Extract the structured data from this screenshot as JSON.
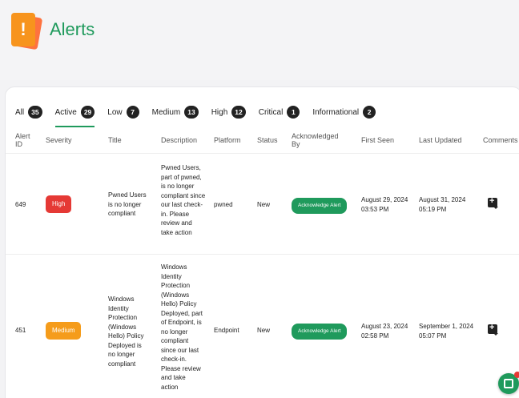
{
  "page": {
    "title": "Alerts"
  },
  "tabs": [
    {
      "label": "All",
      "count": "35"
    },
    {
      "label": "Active",
      "count": "29"
    },
    {
      "label": "Low",
      "count": "7"
    },
    {
      "label": "Medium",
      "count": "13"
    },
    {
      "label": "High",
      "count": "12"
    },
    {
      "label": "Critical",
      "count": "1"
    },
    {
      "label": "Informational",
      "count": "2"
    }
  ],
  "table": {
    "headers": {
      "alert_id": "Alert ID",
      "severity": "Severity",
      "title": "Title",
      "description": "Description",
      "platform": "Platform",
      "status": "Status",
      "acknowledged_by": "Acknowledged By",
      "first_seen": "First Seen",
      "last_updated": "Last Updated",
      "comments": "Comments"
    },
    "rows": [
      {
        "alert_id": "649",
        "severity": "High",
        "title": "Pwned Users is no longer compliant",
        "description": "Pwned Users, part of pwned, is no longer compliant since our last check-in. Please review and take action",
        "platform": "pwned",
        "status": "New",
        "ack_button": "Acknowledge Alert",
        "first_seen_date": "August 29, 2024",
        "first_seen_time": "03:53 PM",
        "last_updated_date": "August 31, 2024",
        "last_updated_time": "05:19 PM"
      },
      {
        "alert_id": "451",
        "severity": "Medium",
        "title": "Windows Identity Protection (Windows Hello) Policy Deployed is no longer compliant",
        "description": "Windows Identity Protection (Windows Hello) Policy Deployed, part of Endpoint, is no longer compliant since our last check-in. Please review and take action",
        "platform": "Endpoint",
        "status": "New",
        "ack_button": "Acknowledge Alert",
        "first_seen_date": "August 23, 2024",
        "first_seen_time": "02:58 PM",
        "last_updated_date": "September 1, 2024",
        "last_updated_time": "05:07 PM"
      }
    ]
  },
  "colors": {
    "accent": "#1f9a5c",
    "high": "#e53935",
    "medium": "#f59c1b"
  },
  "icons": {
    "header": "alert-icon",
    "comment": "add-comment-icon",
    "fab": "chat-icon"
  }
}
